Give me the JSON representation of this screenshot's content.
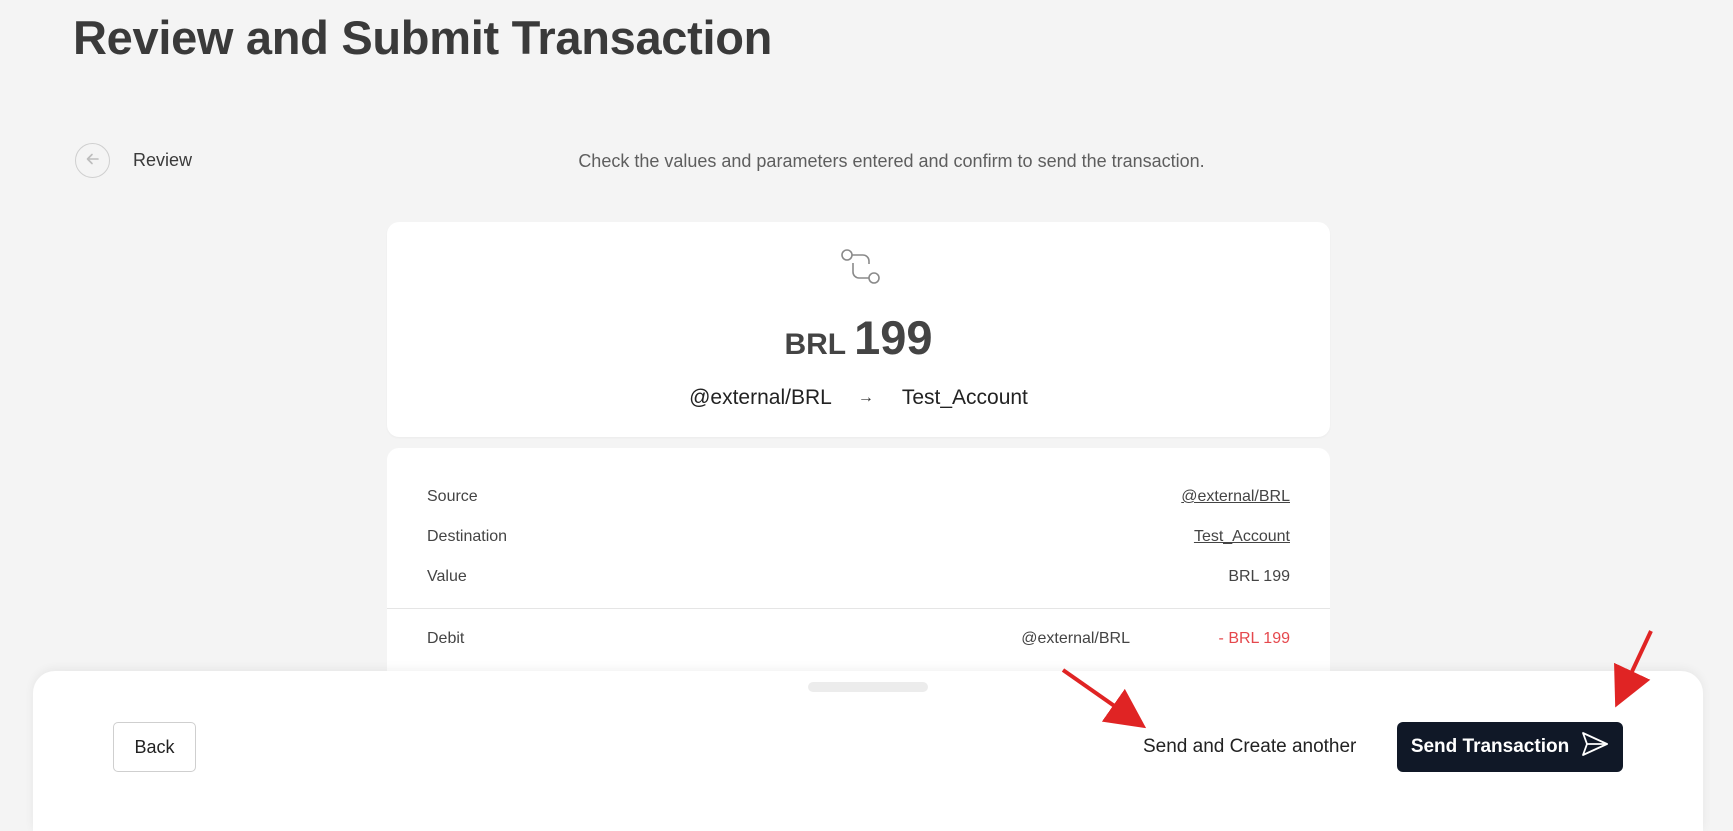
{
  "page": {
    "title": "Review and Submit Transaction",
    "step_label": "Review",
    "subtitle": "Check the values and parameters entered and confirm to send the transaction."
  },
  "summary": {
    "currency": "BRL",
    "amount": "199",
    "source": "@external/BRL",
    "arrow": "→",
    "destination": "Test_Account"
  },
  "details": {
    "rows": [
      {
        "label": "Source",
        "value": "@external/BRL"
      },
      {
        "label": "Destination",
        "value": "Test_Account"
      },
      {
        "label": "Value",
        "value": "BRL 199"
      }
    ],
    "debit": {
      "label": "Debit",
      "account": "@external/BRL",
      "amount": "- BRL 199"
    }
  },
  "footer": {
    "back_label": "Back",
    "another_label": "Send and Create another",
    "send_label": "Send Transaction"
  },
  "icons": {
    "back": "arrow-left-icon",
    "transfer": "transfer-route-icon",
    "send": "send-paper-plane-icon"
  },
  "colors": {
    "background": "#f4f4f4",
    "primary_button": "#101827",
    "debit_amount": "#e5484d",
    "annotation_arrow": "#e02424"
  }
}
